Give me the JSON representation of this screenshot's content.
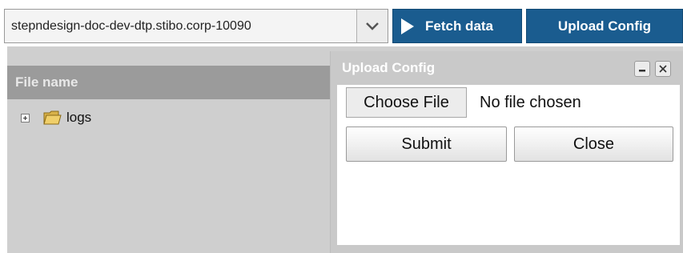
{
  "toolbar": {
    "server": "stepndesign-doc-dev-dtp.stibo.corp-10090",
    "fetch_label": "Fetch data",
    "upload_label": "Upload Config"
  },
  "file_panel": {
    "header": "File name",
    "items": [
      {
        "label": "logs",
        "icon": "folder-icon",
        "expander": "plus-box-icon"
      }
    ]
  },
  "dialog": {
    "title": "Upload Config",
    "choose_label": "Choose File",
    "file_status": "No file chosen",
    "submit_label": "Submit",
    "close_label": "Close"
  },
  "colors": {
    "accent": "#1a5c8f",
    "panel": "#cfcfcf",
    "header": "#9b9b9b"
  }
}
